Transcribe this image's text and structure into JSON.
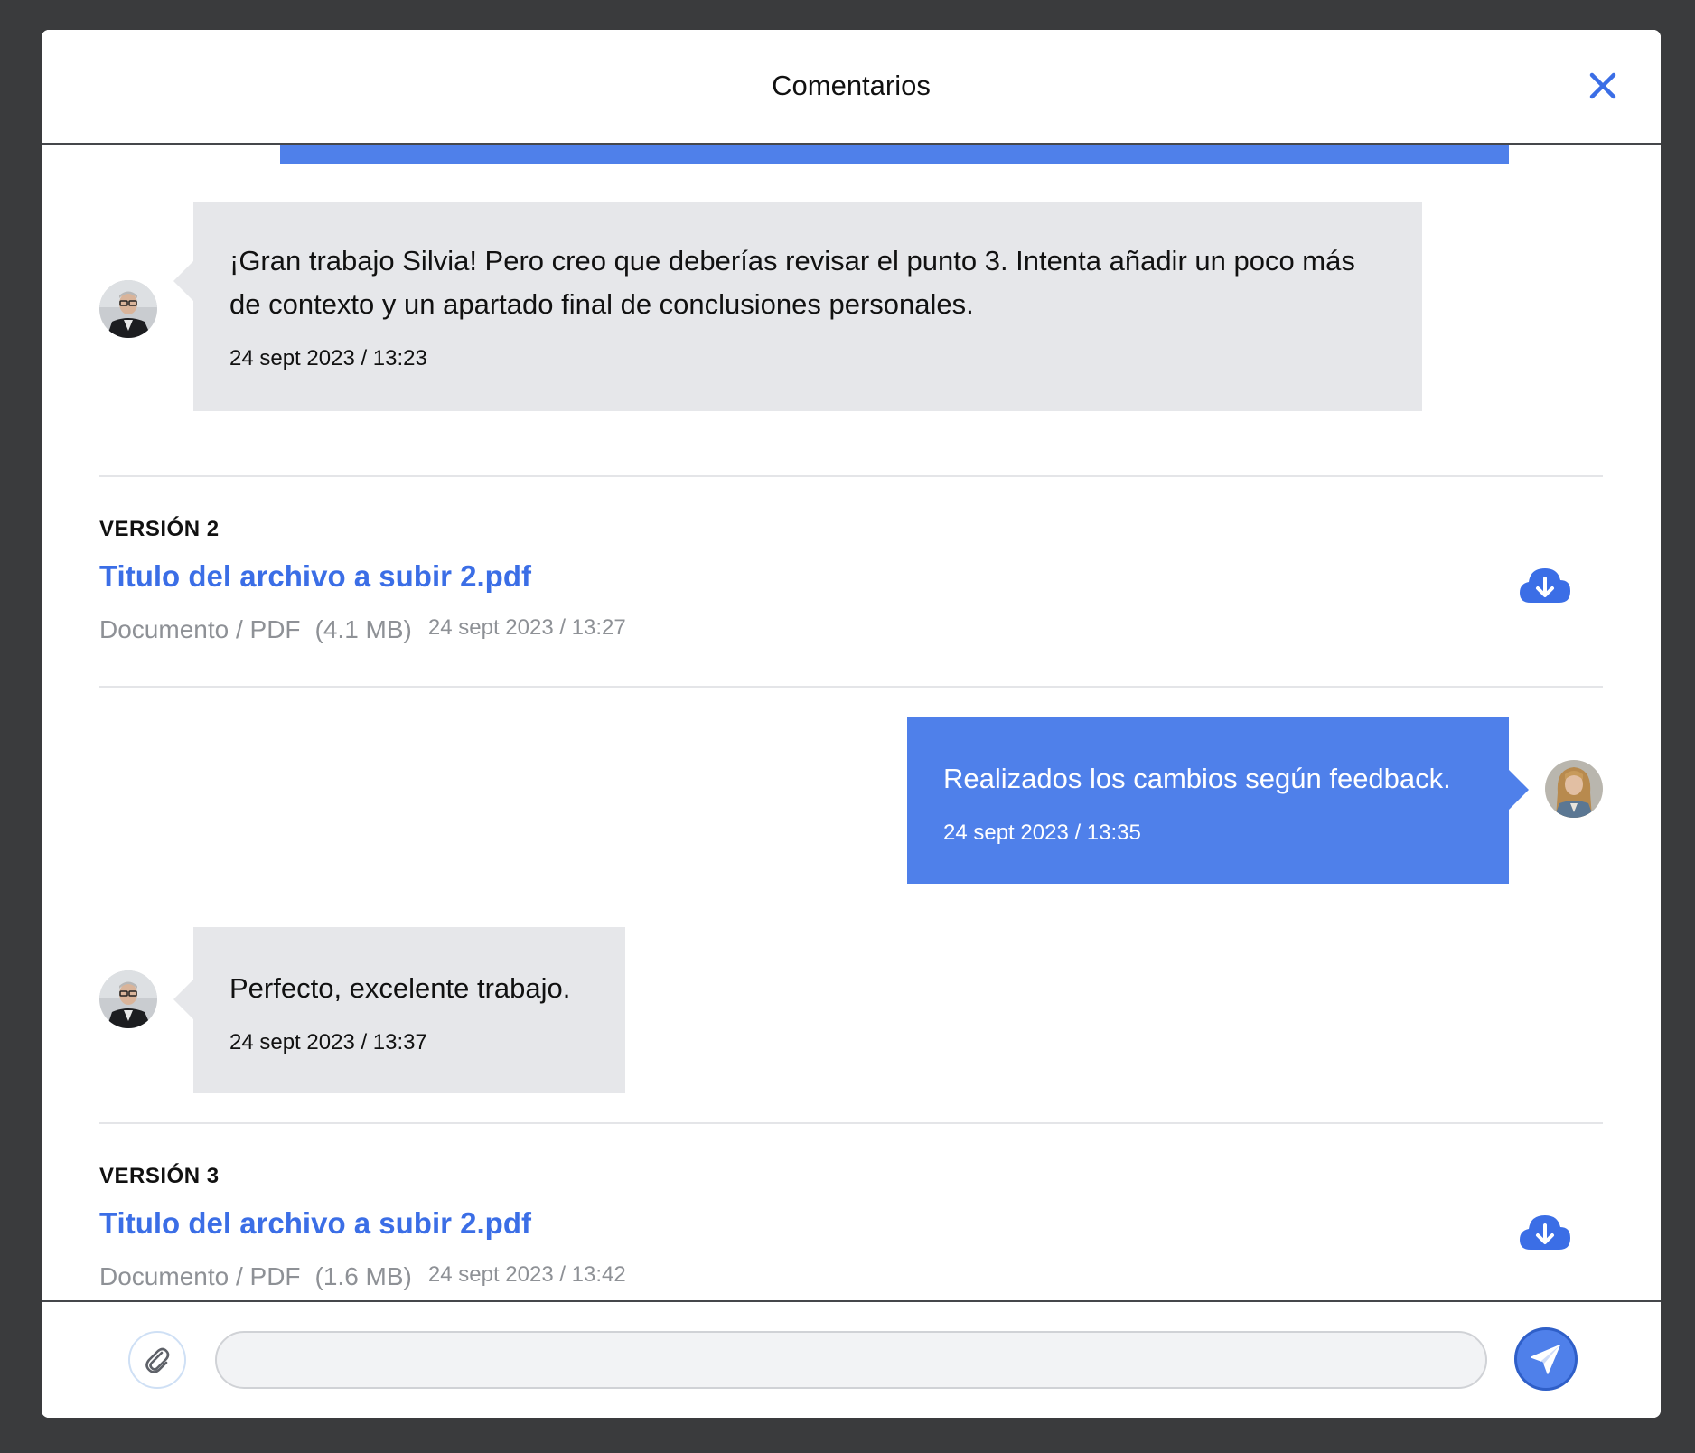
{
  "modal": {
    "title": "Comentarios"
  },
  "messages": [
    {
      "author": "reviewer",
      "text": "¡Gran trabajo Silvia! Pero creo que deberías revisar el punto 3. Intenta añadir un poco más de contexto y un apartado final de conclusiones personales.",
      "timestamp": "24 sept 2023 / 13:23"
    },
    {
      "author": "self",
      "text": "Realizados los cambios según feedback.",
      "timestamp": "24 sept 2023 / 13:35"
    },
    {
      "author": "reviewer",
      "text": "Perfecto, excelente trabajo.",
      "timestamp": "24 sept 2023 / 13:37"
    }
  ],
  "versions": [
    {
      "label": "VERSIÓN 2",
      "file_name": "Titulo del archivo a subir 2.pdf",
      "type": "Documento / PDF",
      "size": "(4.1 MB)",
      "date": "24 sept 2023 / 13:27"
    },
    {
      "label": "VERSIÓN 3",
      "file_name": "Titulo del archivo a subir 2.pdf",
      "type": "Documento / PDF",
      "size": "(1.6 MB)",
      "date": "24 sept 2023 / 13:42"
    }
  ],
  "composer": {
    "value": "",
    "placeholder": ""
  },
  "icons": {
    "close": "close-icon",
    "download": "cloud-download-icon",
    "attach": "paperclip-icon",
    "send": "paper-plane-icon"
  },
  "colors": {
    "accent": "#4f80ea",
    "link": "#3b6ee6",
    "bubble_gray": "#e6e7ea",
    "backdrop": "#3a3b3d"
  }
}
